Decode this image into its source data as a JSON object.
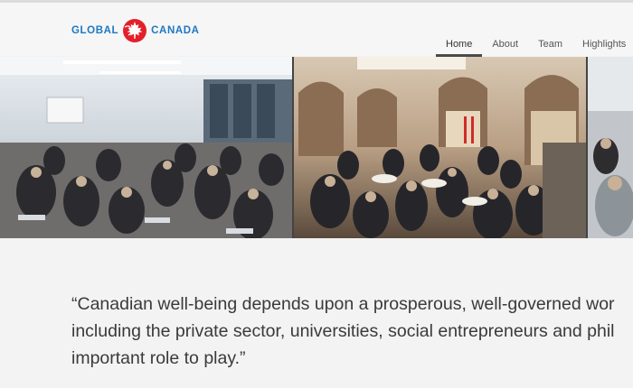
{
  "brand": {
    "left_word": "GLOBAL",
    "right_word": "CANADA",
    "globe_icon": "red-maple-leaf-globe",
    "accent_color": "#1c78c3",
    "globe_color": "#e3202a"
  },
  "nav": {
    "items": [
      {
        "label": "Home",
        "active": true
      },
      {
        "label": "About",
        "active": false
      },
      {
        "label": "Team",
        "active": false
      },
      {
        "label": "Highlights",
        "active": false
      }
    ]
  },
  "banner": {
    "photos": [
      {
        "subject": "conference-room-audience"
      },
      {
        "subject": "atrium-reception-crowd"
      },
      {
        "subject": "seated-guests-partial"
      }
    ]
  },
  "quote": {
    "text": "“Canadian well-being depends upon a prosperous, well-governed wor\nincluding the private sector, universities, social entrepreneurs and phil\nimportant role to play.”"
  }
}
